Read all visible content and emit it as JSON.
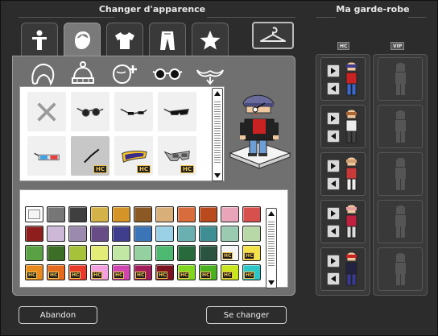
{
  "window": {
    "title": "Changer d'apparence",
    "wardrobe_title": "Ma garde-robe"
  },
  "tabs": [
    {
      "id": "body",
      "icon": "body-icon",
      "active": false
    },
    {
      "id": "head",
      "icon": "head-icon",
      "active": true
    },
    {
      "id": "shirt",
      "icon": "shirt-icon",
      "active": false
    },
    {
      "id": "pants",
      "icon": "pants-icon",
      "active": false
    },
    {
      "id": "extras",
      "icon": "star-icon",
      "active": false
    }
  ],
  "hanger_icon": "hanger-icon",
  "subcategories": [
    "hair-icon",
    "hat-icon",
    "head-accessory-add-icon",
    "glasses-icon",
    "moustache-icon"
  ],
  "items": {
    "badge": "HC",
    "list": [
      {
        "icon": "remove-x-icon",
        "hc": false,
        "selected": false
      },
      {
        "icon": "round-sunglasses-icon",
        "hc": false,
        "selected": false
      },
      {
        "icon": "thin-glasses-icon",
        "hc": false,
        "selected": false
      },
      {
        "icon": "dark-shades-icon",
        "hc": false,
        "selected": false
      },
      {
        "icon": "3d-glasses-icon",
        "hc": false,
        "selected": false
      },
      {
        "icon": "monocle-icon",
        "hc": true,
        "selected": true
      },
      {
        "icon": "visor-glasses-icon",
        "hc": true,
        "selected": false
      },
      {
        "icon": "gray-visor-icon",
        "hc": true,
        "selected": false
      }
    ]
  },
  "colors": {
    "badge": "HC",
    "rows": [
      [
        "#f5f5f5",
        "#777777",
        "#3f3f3f",
        "#d4b24a",
        "#d49428",
        "#8b5a24",
        "#d9b07a",
        "#d86c3c",
        "#b84a1e",
        "#e8a4b8",
        "#d8504e"
      ],
      [
        "#8e1e1e",
        "#cdb8d8",
        "#9c8aae",
        "#674c86",
        "#3f3e8c",
        "#3c74b8",
        "#9bd1e6",
        "#6ab0b0",
        "#3e8e94",
        "#9acbb0",
        "#b8d8a8"
      ],
      [
        "#5aa044",
        "#3c6e28",
        "#a6c23a",
        "#e4ec78",
        "#c2e6a4",
        "#94d0a0",
        "#4cb870",
        "#286a3c",
        "#2a5440",
        "#f4f4f4",
        "#f4e24a"
      ],
      [
        "#e88a1e",
        "#e46a1e",
        "#e83a28",
        "#f2a0e0",
        "#d046b0",
        "#a01c5a",
        "#7a1220",
        "#7ed61e",
        "#4ab020",
        "#c8e61e",
        "#2cc8c8"
      ]
    ],
    "hc_flags": [
      [
        false,
        false,
        false,
        false,
        false,
        false,
        false,
        false,
        false,
        false,
        false
      ],
      [
        false,
        false,
        false,
        false,
        false,
        false,
        false,
        false,
        false,
        false,
        false
      ],
      [
        false,
        false,
        false,
        false,
        false,
        false,
        false,
        false,
        false,
        true,
        true
      ],
      [
        true,
        true,
        true,
        true,
        true,
        true,
        true,
        true,
        true,
        true,
        true
      ]
    ],
    "selected": [
      0,
      0
    ]
  },
  "buttons": {
    "cancel": "Abandon",
    "confirm": "Se changer"
  },
  "wardrobe": {
    "hc_label": "HC",
    "vip_label": "VIP",
    "hc_slots": 5,
    "vip_slots": 5
  }
}
